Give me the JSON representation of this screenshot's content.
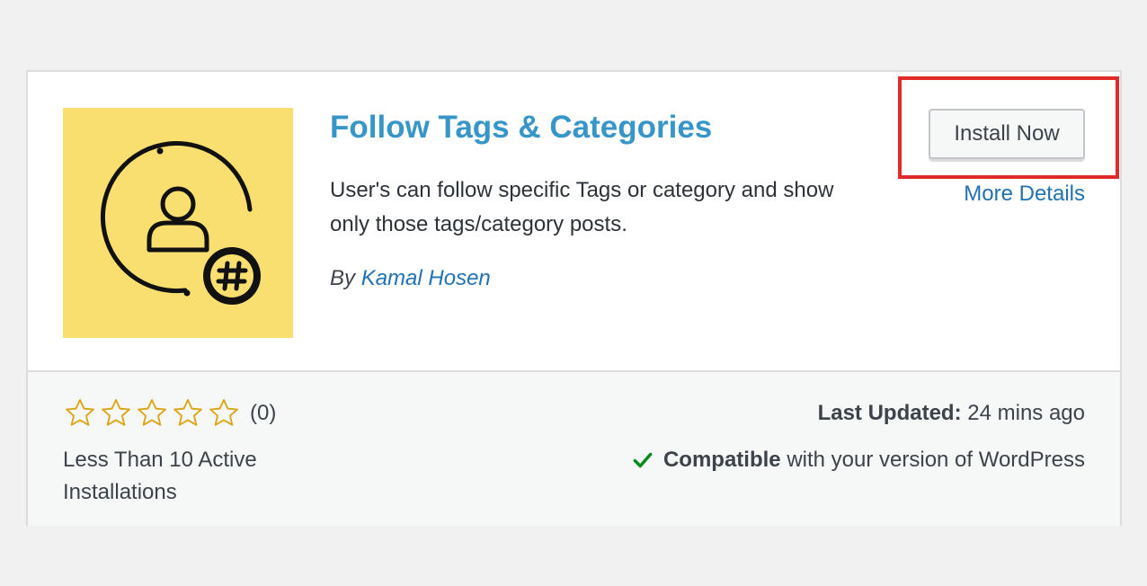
{
  "plugin": {
    "name": "Follow Tags & Categories",
    "description": "User's can follow specific Tags or category and show only those tags/category posts.",
    "author_prefix": "By",
    "author_name": "Kamal Hosen",
    "icon": "user-hashtag-icon",
    "icon_background": "#f9df70"
  },
  "actions": {
    "install_label": "Install Now",
    "more_details_label": "More Details"
  },
  "rating": {
    "stars_filled": 0,
    "stars_total": 5,
    "count_label": "(0)"
  },
  "installs": {
    "label": "Less Than 10 Active Installations"
  },
  "updated": {
    "label": "Last Updated:",
    "value": "24 mins ago"
  },
  "compatibility": {
    "strong": "Compatible",
    "rest": "with your version of WordPress",
    "icon": "check-icon"
  },
  "colors": {
    "title": "#3795c7",
    "link": "#2271b1",
    "highlight": "#e02b2b",
    "star": "#dba617",
    "check": "#008a20"
  }
}
